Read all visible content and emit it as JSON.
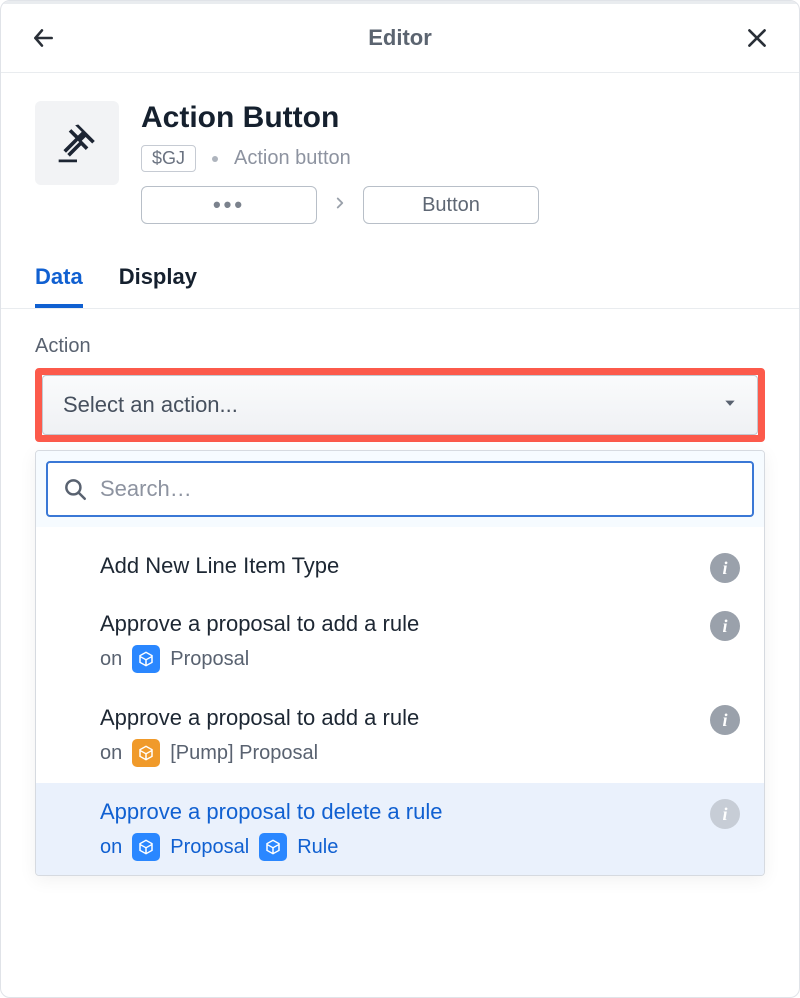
{
  "topbar": {
    "title": "Editor"
  },
  "header": {
    "title": "Action Button",
    "token": "$GJ",
    "type_label": "Action button"
  },
  "breadcrumb": {
    "ellipsis": "• • •",
    "last": "Button"
  },
  "tabs": {
    "data": "Data",
    "display": "Display"
  },
  "section": {
    "label": "Action",
    "select_placeholder": "Select an action...",
    "search_placeholder": "Search…",
    "on_word": "on"
  },
  "options": [
    {
      "title": "Add New Line Item Type",
      "targets": []
    },
    {
      "title": "Approve a proposal to add a rule",
      "targets": [
        {
          "color": "blue",
          "label": "Proposal"
        }
      ]
    },
    {
      "title": "Approve a proposal to add a rule",
      "targets": [
        {
          "color": "orange",
          "label": "[Pump] Proposal"
        }
      ]
    },
    {
      "title": "Approve a proposal to delete a rule",
      "selected": true,
      "targets": [
        {
          "color": "blue",
          "label": "Proposal"
        },
        {
          "color": "blue",
          "label": "Rule"
        }
      ]
    }
  ]
}
